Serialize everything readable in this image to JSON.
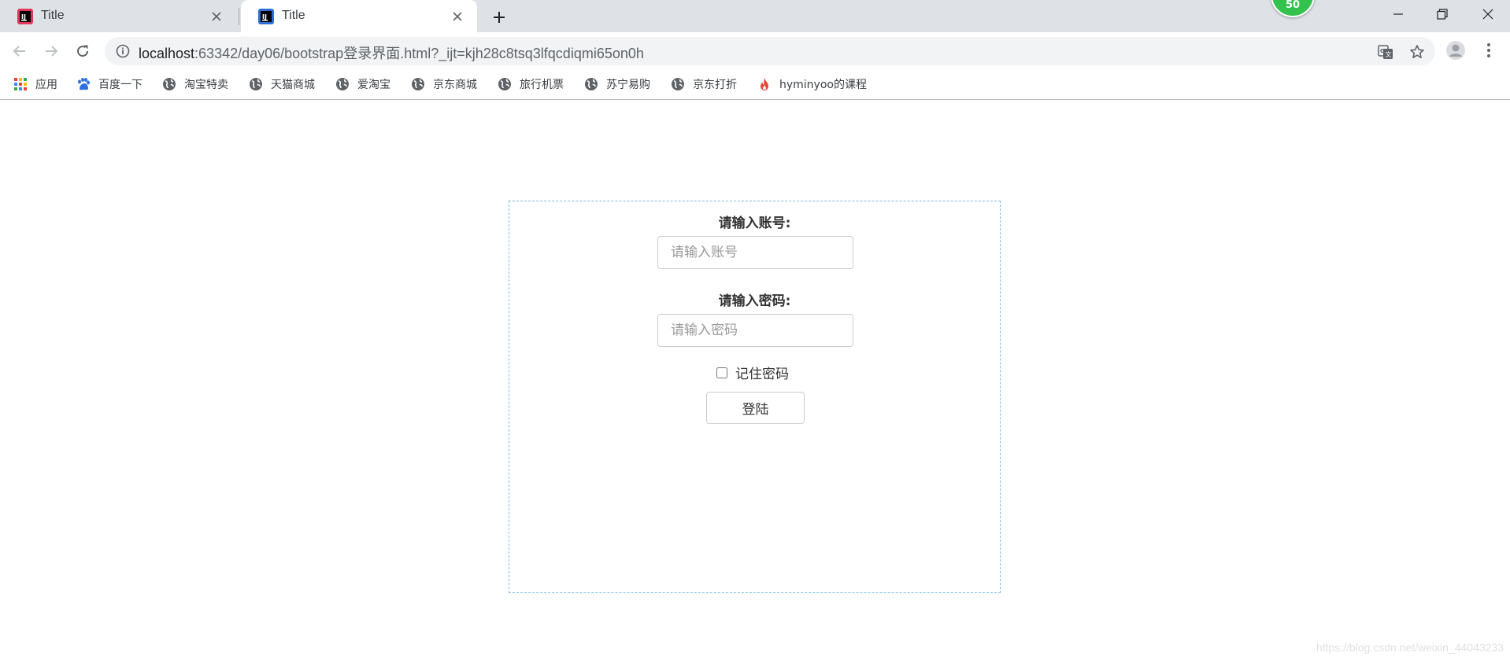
{
  "browser": {
    "tabs": [
      {
        "title": "Title",
        "active": false
      },
      {
        "title": "Title",
        "active": true
      }
    ],
    "badge_count": "50",
    "url_host": "localhost",
    "url_rest": ":63342/day06/bootstrap登录界面.html?_ijt=kjh28c8tsq3lfqcdiqmi65on0h"
  },
  "bookmarks": [
    {
      "label": "应用",
      "icon": "apps-grid-icon"
    },
    {
      "label": "百度一下",
      "icon": "baidu-paw-icon"
    },
    {
      "label": "淘宝特卖",
      "icon": "globe-icon"
    },
    {
      "label": "天猫商城",
      "icon": "globe-icon"
    },
    {
      "label": "爱淘宝",
      "icon": "globe-icon"
    },
    {
      "label": "京东商城",
      "icon": "globe-icon"
    },
    {
      "label": "旅行机票",
      "icon": "globe-icon"
    },
    {
      "label": "苏宁易购",
      "icon": "globe-icon"
    },
    {
      "label": "京东打折",
      "icon": "globe-icon"
    },
    {
      "label": "hyminyoo的课程",
      "icon": "flame-icon"
    }
  ],
  "login": {
    "account_label": "请输入账号:",
    "account_placeholder": "请输入账号",
    "password_label": "请输入密码:",
    "password_placeholder": "请输入密码",
    "remember_label": "记住密码",
    "submit_label": "登陆"
  },
  "watermark": "https://blog.csdn.net/weixin_44043233",
  "colors": {
    "tabstrip": "#dee1e6",
    "badge": "#32c24d",
    "box_border": "#7bbce8"
  }
}
